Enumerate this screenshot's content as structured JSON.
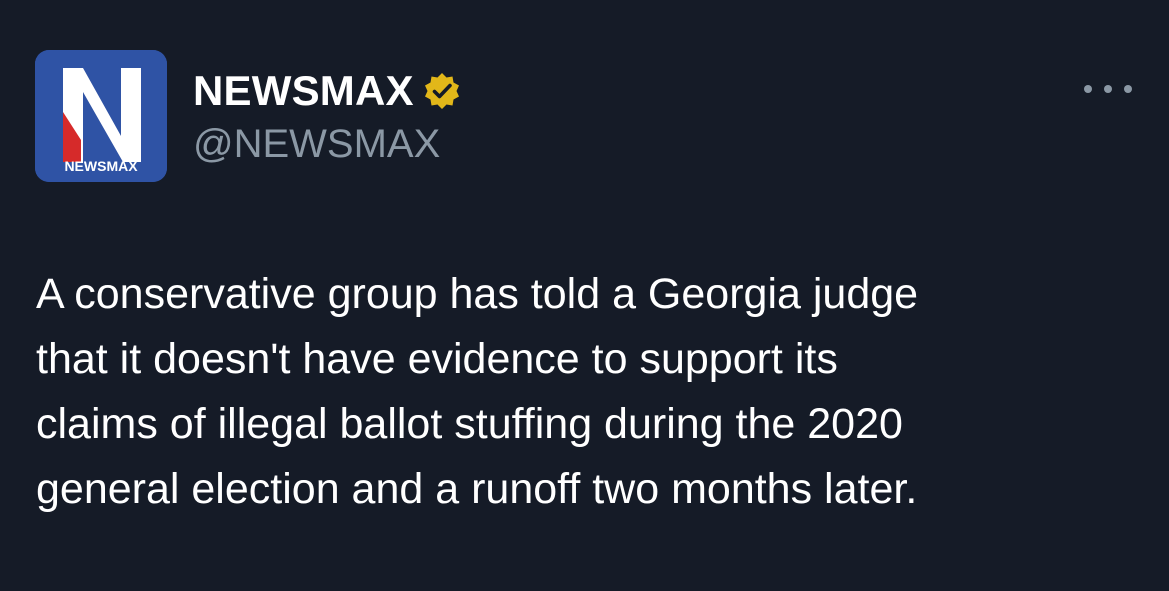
{
  "account": {
    "avatar_text": "NEWSMAX",
    "display_name": "NEWSMAX",
    "handle": "@NEWSMAX",
    "verified_icon": "gold-verified-badge-icon",
    "more_icon": "more-options-icon"
  },
  "tweet": {
    "text_lines": [
      "A conservative group has told a Georgia judge",
      "that it doesn't have evidence to support its",
      "claims of illegal ballot stuffing during the 2020",
      "general election and a runoff two months later."
    ]
  },
  "colors": {
    "background": "#151b27",
    "text": "#ffffff",
    "secondary_text": "#8b98a5",
    "avatar_blue": "#2f53a5",
    "avatar_red": "#d62a2a",
    "badge_gold": "#e2b719"
  }
}
